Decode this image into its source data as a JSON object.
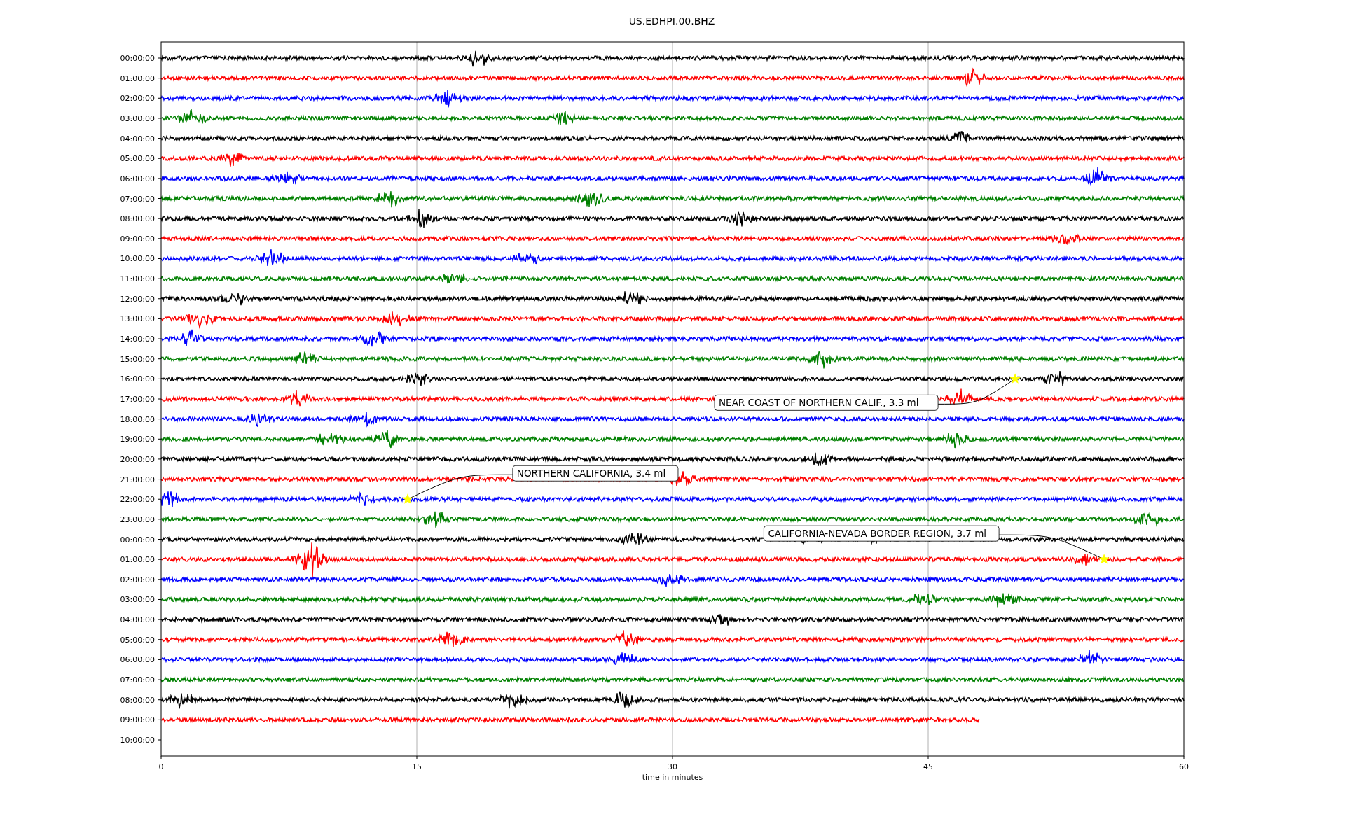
{
  "title": "US.EDHPI.00.BHZ",
  "xlabel": "time in minutes",
  "xticks": [
    "0",
    "15",
    "30",
    "45",
    "60"
  ],
  "rows": [
    {
      "label": "00:00:00",
      "color": "#000000",
      "level": 1
    },
    {
      "label": "01:00:00",
      "color": "#ff0000",
      "level": 1
    },
    {
      "label": "02:00:00",
      "color": "#0000ff",
      "level": 1
    },
    {
      "label": "03:00:00",
      "color": "#008000",
      "level": 1
    },
    {
      "label": "04:00:00",
      "color": "#000000",
      "level": 1
    },
    {
      "label": "05:00:00",
      "color": "#ff0000",
      "level": 1
    },
    {
      "label": "06:00:00",
      "color": "#0000ff",
      "level": 1
    },
    {
      "label": "07:00:00",
      "color": "#008000",
      "level": 1
    },
    {
      "label": "08:00:00",
      "color": "#000000",
      "level": 1
    },
    {
      "label": "09:00:00",
      "color": "#ff0000",
      "level": 1
    },
    {
      "label": "10:00:00",
      "color": "#0000ff",
      "level": 1
    },
    {
      "label": "11:00:00",
      "color": "#008000",
      "level": 1
    },
    {
      "label": "12:00:00",
      "color": "#000000",
      "level": 1
    },
    {
      "label": "13:00:00",
      "color": "#ff0000",
      "level": 1
    },
    {
      "label": "14:00:00",
      "color": "#0000ff",
      "level": 1
    },
    {
      "label": "15:00:00",
      "color": "#008000",
      "level": 1
    },
    {
      "label": "16:00:00",
      "color": "#000000",
      "level": 1,
      "event": {
        "label": "NEAR COAST OF NORTHERN CALIF., 3.3 ml",
        "level": 0.835,
        "kind": "below"
      }
    },
    {
      "label": "17:00:00",
      "color": "#ff0000",
      "level": 1
    },
    {
      "label": "18:00:00",
      "color": "#0000ff",
      "level": 1
    },
    {
      "label": "19:00:00",
      "color": "#008000",
      "level": 1
    },
    {
      "label": "20:00:00",
      "color": "#000000",
      "level": 1
    },
    {
      "label": "21:00:00",
      "color": "#ff0000",
      "level": 1
    },
    {
      "label": "22:00:00",
      "color": "#0000ff",
      "level": 1,
      "event": {
        "label": "NORTHERN CALIFORNIA, 3.4 ml",
        "level": 0.241,
        "kind": "above"
      }
    },
    {
      "label": "23:00:00",
      "color": "#008000",
      "level": 1
    },
    {
      "label": "00:00:00",
      "color": "#000000",
      "level": 1
    },
    {
      "label": "01:00:00",
      "color": "#ff0000",
      "level": 1,
      "event": {
        "label": "CALIFORNIA-NEVADA BORDER REGION, 3.7 ml",
        "level": 0.922,
        "kind": "above"
      }
    },
    {
      "label": "02:00:00",
      "color": "#0000ff",
      "level": 1
    },
    {
      "label": "03:00:00",
      "color": "#008000",
      "level": 1
    },
    {
      "label": "04:00:00",
      "color": "#000000",
      "level": 1
    },
    {
      "label": "05:00:00",
      "color": "#ff0000",
      "level": 1
    },
    {
      "label": "06:00:00",
      "color": "#0000ff",
      "level": 1
    },
    {
      "label": "07:00:00",
      "color": "#008000",
      "level": 1
    },
    {
      "label": "08:00:00",
      "color": "#000000",
      "level": 1
    },
    {
      "label": "09:00:00",
      "color": "#ff0000",
      "level": 0.8
    },
    {
      "label": "10:00:00"
    }
  ]
}
